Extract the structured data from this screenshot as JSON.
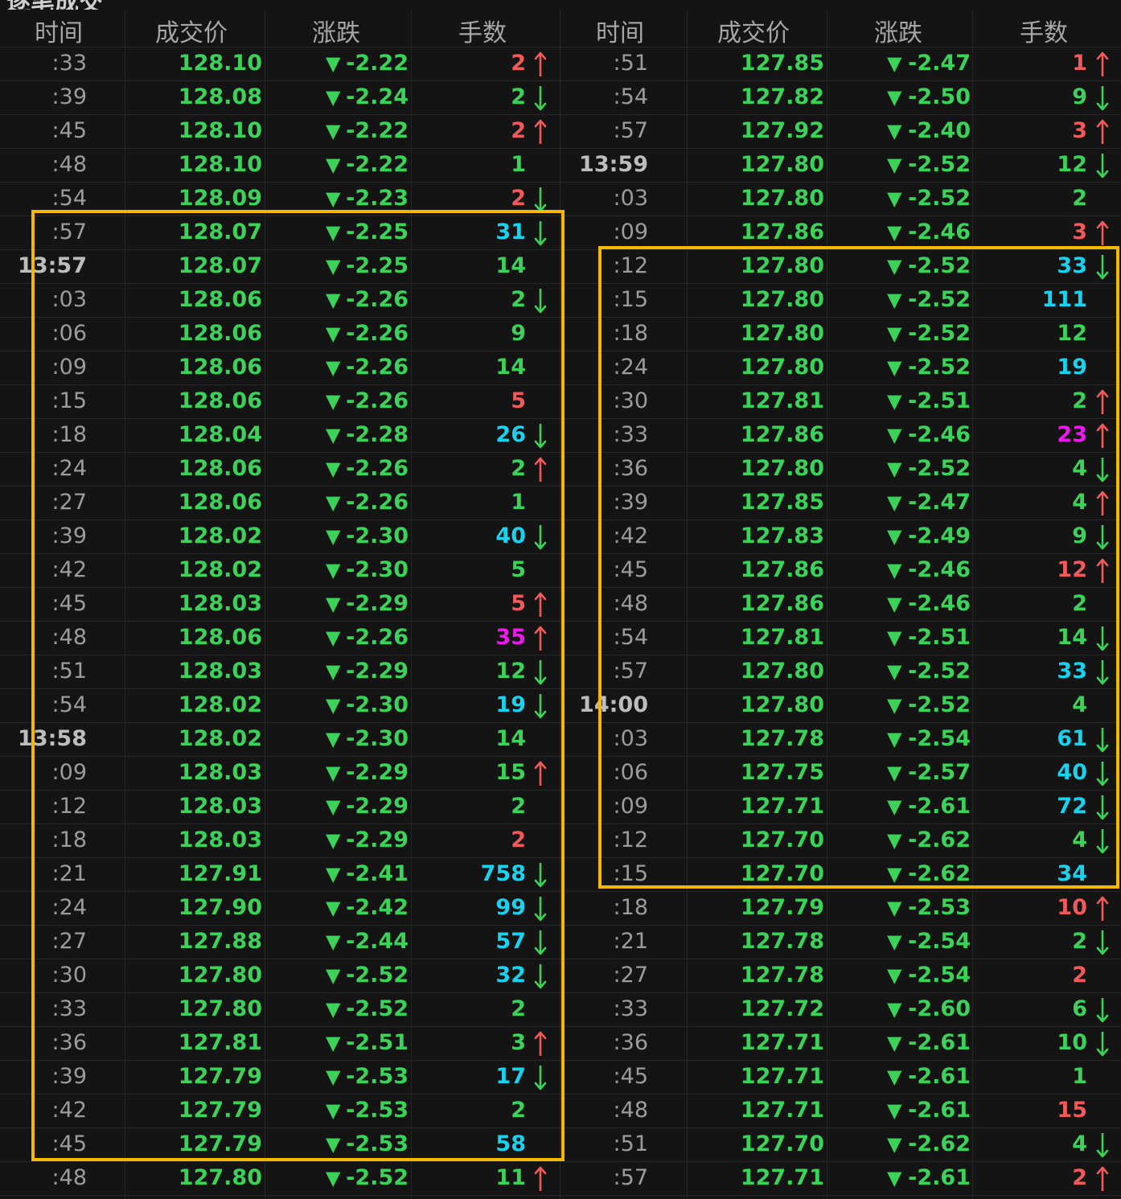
{
  "title_partial": "逐笔成交",
  "colors": {
    "background": "#141414",
    "price_green": "#3cd25a",
    "volume_red": "#f05a5a",
    "volume_green": "#3cd25a",
    "volume_cyan": "#19d2ee",
    "volume_magenta": "#ee19ee",
    "highlight_box": "#f5b800"
  },
  "headers": {
    "time": "时间",
    "price": "成交价",
    "change": "涨跌",
    "volume": "手数"
  },
  "down_marker": "▼",
  "left_rows": [
    {
      "time": ":33",
      "price": "128.10",
      "change": "-2.22",
      "vol": "2",
      "vc": "red",
      "arrow": "up"
    },
    {
      "time": ":39",
      "price": "128.08",
      "change": "-2.24",
      "vol": "2",
      "vc": "green",
      "arrow": "down"
    },
    {
      "time": ":45",
      "price": "128.10",
      "change": "-2.22",
      "vol": "2",
      "vc": "red",
      "arrow": "up"
    },
    {
      "time": ":48",
      "price": "128.10",
      "change": "-2.22",
      "vol": "1",
      "vc": "green",
      "arrow": ""
    },
    {
      "time": ":54",
      "price": "128.09",
      "change": "-2.23",
      "vol": "2",
      "vc": "red",
      "arrow": "down"
    },
    {
      "time": ":57",
      "price": "128.07",
      "change": "-2.25",
      "vol": "31",
      "vc": "cyan",
      "arrow": "down"
    },
    {
      "time": "13:57",
      "price": "128.07",
      "change": "-2.25",
      "vol": "14",
      "vc": "green",
      "arrow": "",
      "hour": true
    },
    {
      "time": ":03",
      "price": "128.06",
      "change": "-2.26",
      "vol": "2",
      "vc": "green",
      "arrow": "down"
    },
    {
      "time": ":06",
      "price": "128.06",
      "change": "-2.26",
      "vol": "9",
      "vc": "green",
      "arrow": ""
    },
    {
      "time": ":09",
      "price": "128.06",
      "change": "-2.26",
      "vol": "14",
      "vc": "green",
      "arrow": ""
    },
    {
      "time": ":15",
      "price": "128.06",
      "change": "-2.26",
      "vol": "5",
      "vc": "red",
      "arrow": ""
    },
    {
      "time": ":18",
      "price": "128.04",
      "change": "-2.28",
      "vol": "26",
      "vc": "cyan",
      "arrow": "down"
    },
    {
      "time": ":24",
      "price": "128.06",
      "change": "-2.26",
      "vol": "2",
      "vc": "green",
      "arrow": "up"
    },
    {
      "time": ":27",
      "price": "128.06",
      "change": "-2.26",
      "vol": "1",
      "vc": "green",
      "arrow": ""
    },
    {
      "time": ":39",
      "price": "128.02",
      "change": "-2.30",
      "vol": "40",
      "vc": "cyan",
      "arrow": "down"
    },
    {
      "time": ":42",
      "price": "128.02",
      "change": "-2.30",
      "vol": "5",
      "vc": "green",
      "arrow": ""
    },
    {
      "time": ":45",
      "price": "128.03",
      "change": "-2.29",
      "vol": "5",
      "vc": "red",
      "arrow": "up"
    },
    {
      "time": ":48",
      "price": "128.06",
      "change": "-2.26",
      "vol": "35",
      "vc": "magenta",
      "arrow": "up"
    },
    {
      "time": ":51",
      "price": "128.03",
      "change": "-2.29",
      "vol": "12",
      "vc": "green",
      "arrow": "down"
    },
    {
      "time": ":54",
      "price": "128.02",
      "change": "-2.30",
      "vol": "19",
      "vc": "cyan",
      "arrow": "down"
    },
    {
      "time": "13:58",
      "price": "128.02",
      "change": "-2.30",
      "vol": "14",
      "vc": "green",
      "arrow": "",
      "hour": true
    },
    {
      "time": ":09",
      "price": "128.03",
      "change": "-2.29",
      "vol": "15",
      "vc": "green",
      "arrow": "up"
    },
    {
      "time": ":12",
      "price": "128.03",
      "change": "-2.29",
      "vol": "2",
      "vc": "green",
      "arrow": ""
    },
    {
      "time": ":18",
      "price": "128.03",
      "change": "-2.29",
      "vol": "2",
      "vc": "red",
      "arrow": ""
    },
    {
      "time": ":21",
      "price": "127.91",
      "change": "-2.41",
      "vol": "758",
      "vc": "cyan",
      "arrow": "down"
    },
    {
      "time": ":24",
      "price": "127.90",
      "change": "-2.42",
      "vol": "99",
      "vc": "cyan",
      "arrow": "down"
    },
    {
      "time": ":27",
      "price": "127.88",
      "change": "-2.44",
      "vol": "57",
      "vc": "cyan",
      "arrow": "down"
    },
    {
      "time": ":30",
      "price": "127.80",
      "change": "-2.52",
      "vol": "32",
      "vc": "cyan",
      "arrow": "down"
    },
    {
      "time": ":33",
      "price": "127.80",
      "change": "-2.52",
      "vol": "2",
      "vc": "green",
      "arrow": ""
    },
    {
      "time": ":36",
      "price": "127.81",
      "change": "-2.51",
      "vol": "3",
      "vc": "green",
      "arrow": "up"
    },
    {
      "time": ":39",
      "price": "127.79",
      "change": "-2.53",
      "vol": "17",
      "vc": "cyan",
      "arrow": "down"
    },
    {
      "time": ":42",
      "price": "127.79",
      "change": "-2.53",
      "vol": "2",
      "vc": "green",
      "arrow": ""
    },
    {
      "time": ":45",
      "price": "127.79",
      "change": "-2.53",
      "vol": "58",
      "vc": "cyan",
      "arrow": ""
    },
    {
      "time": ":48",
      "price": "127.80",
      "change": "-2.52",
      "vol": "11",
      "vc": "green",
      "arrow": "up"
    }
  ],
  "right_rows": [
    {
      "time": ":51",
      "price": "127.85",
      "change": "-2.47",
      "vol": "1",
      "vc": "red",
      "arrow": "up"
    },
    {
      "time": ":54",
      "price": "127.82",
      "change": "-2.50",
      "vol": "9",
      "vc": "green",
      "arrow": "down"
    },
    {
      "time": ":57",
      "price": "127.92",
      "change": "-2.40",
      "vol": "3",
      "vc": "red",
      "arrow": "up"
    },
    {
      "time": "13:59",
      "price": "127.80",
      "change": "-2.52",
      "vol": "12",
      "vc": "green",
      "arrow": "down",
      "hour": true
    },
    {
      "time": ":03",
      "price": "127.80",
      "change": "-2.52",
      "vol": "2",
      "vc": "green",
      "arrow": ""
    },
    {
      "time": ":09",
      "price": "127.86",
      "change": "-2.46",
      "vol": "3",
      "vc": "red",
      "arrow": "up"
    },
    {
      "time": ":12",
      "price": "127.80",
      "change": "-2.52",
      "vol": "33",
      "vc": "cyan",
      "arrow": "down"
    },
    {
      "time": ":15",
      "price": "127.80",
      "change": "-2.52",
      "vol": "111",
      "vc": "cyan",
      "arrow": ""
    },
    {
      "time": ":18",
      "price": "127.80",
      "change": "-2.52",
      "vol": "12",
      "vc": "green",
      "arrow": ""
    },
    {
      "time": ":24",
      "price": "127.80",
      "change": "-2.52",
      "vol": "19",
      "vc": "cyan",
      "arrow": ""
    },
    {
      "time": ":30",
      "price": "127.81",
      "change": "-2.51",
      "vol": "2",
      "vc": "green",
      "arrow": "up"
    },
    {
      "time": ":33",
      "price": "127.86",
      "change": "-2.46",
      "vol": "23",
      "vc": "magenta",
      "arrow": "up"
    },
    {
      "time": ":36",
      "price": "127.80",
      "change": "-2.52",
      "vol": "4",
      "vc": "green",
      "arrow": "down"
    },
    {
      "time": ":39",
      "price": "127.85",
      "change": "-2.47",
      "vol": "4",
      "vc": "green",
      "arrow": "up"
    },
    {
      "time": ":42",
      "price": "127.83",
      "change": "-2.49",
      "vol": "9",
      "vc": "green",
      "arrow": "down"
    },
    {
      "time": ":45",
      "price": "127.86",
      "change": "-2.46",
      "vol": "12",
      "vc": "red",
      "arrow": "up"
    },
    {
      "time": ":48",
      "price": "127.86",
      "change": "-2.46",
      "vol": "2",
      "vc": "green",
      "arrow": ""
    },
    {
      "time": ":54",
      "price": "127.81",
      "change": "-2.51",
      "vol": "14",
      "vc": "green",
      "arrow": "down"
    },
    {
      "time": ":57",
      "price": "127.80",
      "change": "-2.52",
      "vol": "33",
      "vc": "cyan",
      "arrow": "down"
    },
    {
      "time": "14:00",
      "price": "127.80",
      "change": "-2.52",
      "vol": "4",
      "vc": "green",
      "arrow": "",
      "hour": true
    },
    {
      "time": ":03",
      "price": "127.78",
      "change": "-2.54",
      "vol": "61",
      "vc": "cyan",
      "arrow": "down"
    },
    {
      "time": ":06",
      "price": "127.75",
      "change": "-2.57",
      "vol": "40",
      "vc": "cyan",
      "arrow": "down"
    },
    {
      "time": ":09",
      "price": "127.71",
      "change": "-2.61",
      "vol": "72",
      "vc": "cyan",
      "arrow": "down"
    },
    {
      "time": ":12",
      "price": "127.70",
      "change": "-2.62",
      "vol": "4",
      "vc": "green",
      "arrow": "down"
    },
    {
      "time": ":15",
      "price": "127.70",
      "change": "-2.62",
      "vol": "34",
      "vc": "cyan",
      "arrow": ""
    },
    {
      "time": ":18",
      "price": "127.79",
      "change": "-2.53",
      "vol": "10",
      "vc": "red",
      "arrow": "up"
    },
    {
      "time": ":21",
      "price": "127.78",
      "change": "-2.54",
      "vol": "2",
      "vc": "green",
      "arrow": "down"
    },
    {
      "time": ":27",
      "price": "127.78",
      "change": "-2.54",
      "vol": "2",
      "vc": "red",
      "arrow": ""
    },
    {
      "time": ":33",
      "price": "127.72",
      "change": "-2.60",
      "vol": "6",
      "vc": "green",
      "arrow": "down"
    },
    {
      "time": ":36",
      "price": "127.71",
      "change": "-2.61",
      "vol": "10",
      "vc": "green",
      "arrow": "down"
    },
    {
      "time": ":45",
      "price": "127.71",
      "change": "-2.61",
      "vol": "1",
      "vc": "green",
      "arrow": ""
    },
    {
      "time": ":48",
      "price": "127.71",
      "change": "-2.61",
      "vol": "15",
      "vc": "red",
      "arrow": ""
    },
    {
      "time": ":51",
      "price": "127.70",
      "change": "-2.62",
      "vol": "4",
      "vc": "green",
      "arrow": "down"
    },
    {
      "time": ":57",
      "price": "127.71",
      "change": "-2.61",
      "vol": "2",
      "vc": "red",
      "arrow": "up"
    }
  ]
}
